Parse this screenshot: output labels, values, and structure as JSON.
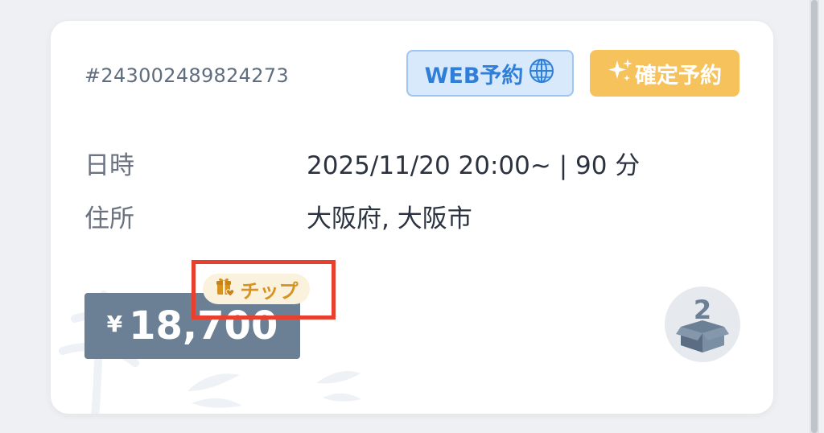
{
  "order": {
    "id": "#243002489824273"
  },
  "badges": {
    "web_label": "WEB予約",
    "web_icon": "globe-icon",
    "confirm_label": "確定予約",
    "confirm_icon": "sparkles-icon"
  },
  "details": {
    "datetime_label": "日時",
    "datetime_value": "2025/11/20 20:00~ | 90 分",
    "address_label": "住所",
    "address_value": "大阪府, 大阪市"
  },
  "price": {
    "currency": "¥",
    "amount": "18,700"
  },
  "tip": {
    "label": "チップ",
    "icon": "gift-heart-icon"
  },
  "package": {
    "count": "2",
    "icon": "box-icon"
  },
  "colors": {
    "accent_blue": "#2f7ed8",
    "accent_gold": "#f6c25b",
    "price_bg": "#6b7f95",
    "highlight": "#e8402f"
  }
}
